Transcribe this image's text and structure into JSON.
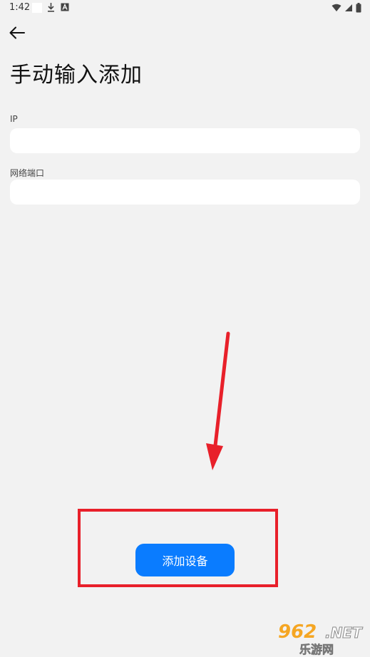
{
  "status_bar": {
    "time": "1:42",
    "icons": [
      "white-square",
      "download-icon",
      "a-icon",
      "wifi-icon",
      "signal-icon",
      "battery-icon"
    ]
  },
  "header": {
    "back_icon": "arrow-left-icon",
    "title": "手动输入添加"
  },
  "form": {
    "ip_label": "IP",
    "ip_value": "",
    "port_label": "网络端口",
    "port_value": ""
  },
  "actions": {
    "add_device_label": "添加设备"
  },
  "annotation": {
    "arrow_color": "#e8202a",
    "box_color": "#e8202a"
  },
  "watermark": {
    "main": "962",
    "suffix": ".NET",
    "sub": "乐游网"
  },
  "colors": {
    "background": "#f2f2f2",
    "accent": "#0a7cff",
    "input_background": "#ffffff"
  }
}
